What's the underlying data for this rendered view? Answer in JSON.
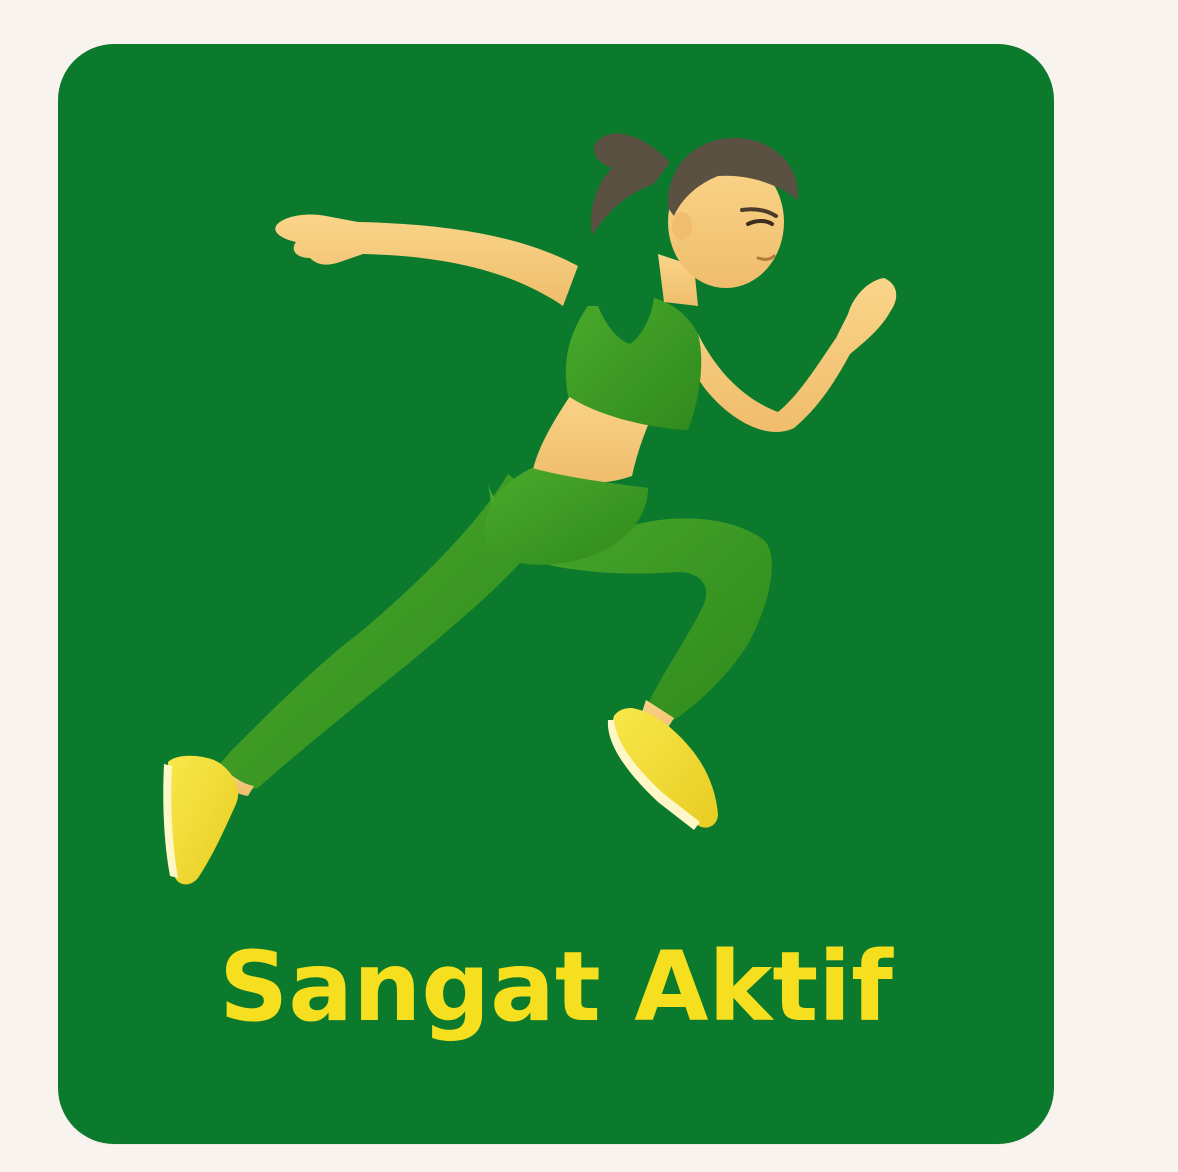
{
  "card": {
    "label": "Sangat Aktif"
  },
  "illustration": {
    "icon": "running-woman-icon"
  },
  "colors": {
    "page_background": "#f8f3ee",
    "card_background": "#0b7a2c",
    "label_text": "#f5df1e",
    "outfit": "#3f9a24",
    "skin": "#f6c97a",
    "hair": "#5a5142",
    "shoes": "#f4e03a"
  }
}
